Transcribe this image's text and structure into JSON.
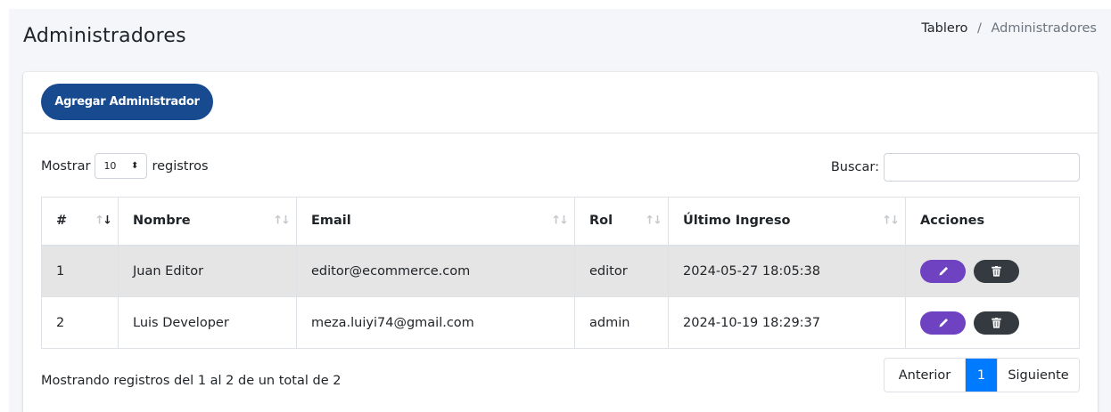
{
  "header": {
    "title": "Administradores",
    "breadcrumb": {
      "home": "Tablero",
      "separator": "/",
      "current": "Administradores"
    }
  },
  "card": {
    "add_button": "Agregar Administrador",
    "length": {
      "prefix": "Mostrar",
      "value": "10",
      "suffix": "registros"
    },
    "search": {
      "label": "Buscar:",
      "value": ""
    }
  },
  "table": {
    "columns": [
      "#",
      "Nombre",
      "Email",
      "Rol",
      "Último Ingreso",
      "Acciones"
    ],
    "rows": [
      {
        "num": "1",
        "name": "Juan Editor",
        "email": "editor@ecommerce.com",
        "role": "editor",
        "last_login": "2024-05-27 18:05:38"
      },
      {
        "num": "2",
        "name": "Luis Developer",
        "email": "meza.luiyi74@gmail.com",
        "role": "admin",
        "last_login": "2024-10-19 18:29:37"
      }
    ]
  },
  "footer": {
    "info": "Mostrando registros del 1 al 2 de un total de 2",
    "pagination": {
      "prev": "Anterior",
      "current": "1",
      "next": "Siguiente"
    }
  },
  "colors": {
    "primary": "#174a8e",
    "edit": "#6f42c1",
    "delete": "#343a40",
    "page_active": "#007bff"
  }
}
